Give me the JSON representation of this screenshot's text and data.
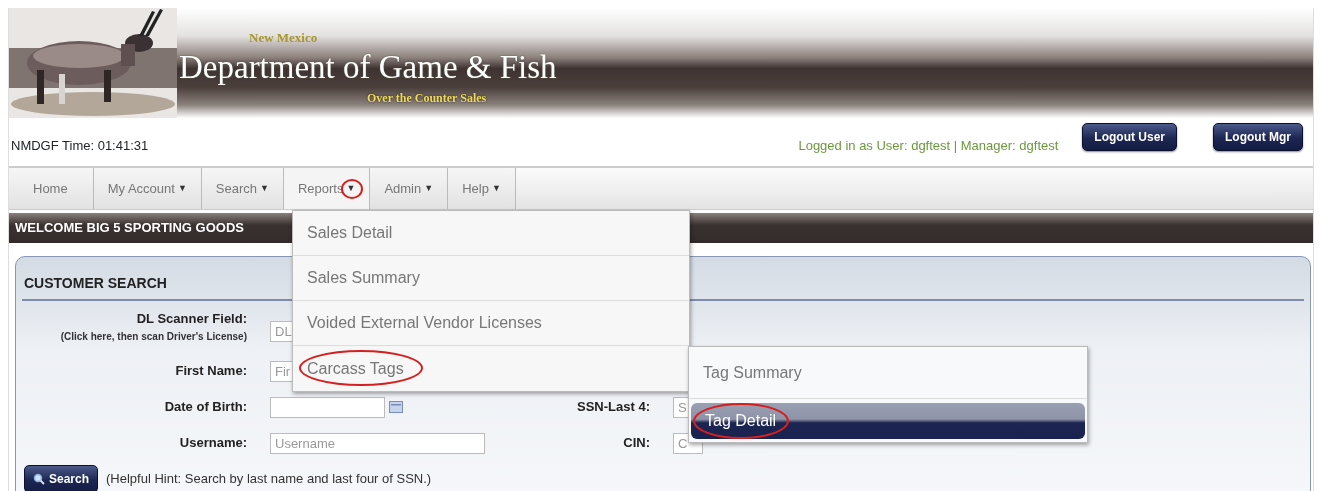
{
  "banner": {
    "state_name": "New Mexico",
    "title": "Department of Game & Fish",
    "subtitle": "Over the Counter Sales"
  },
  "info_bar": {
    "clock": "NMDGF Time: 01:41:31",
    "login": "Logged in as User: dgftest | Manager: dgftest",
    "buttons": [
      "Logout User",
      "Logout Mgr"
    ]
  },
  "nav": [
    {
      "label": "Home",
      "open": false,
      "circled": false
    },
    {
      "label": "My Account",
      "caret": "▼",
      "open": false,
      "circled": false
    },
    {
      "label": "Search",
      "caret": "▼",
      "open": false,
      "circled": false
    },
    {
      "label": "Reports",
      "caret": "▼",
      "open": true,
      "circled": true
    },
    {
      "label": "Admin",
      "caret": "▼",
      "open": false,
      "circled": false
    },
    {
      "label": "Help",
      "caret": "▼",
      "open": false,
      "circled": false
    }
  ],
  "reports_menu": [
    {
      "label": "Sales Detail",
      "circled": false
    },
    {
      "label": "Sales Summary",
      "circled": false
    },
    {
      "label": "Voided External Vendor Licenses",
      "circled": false
    },
    {
      "label": "Carcass Tags",
      "circled": true,
      "children": [
        {
          "label": "Tag Summary",
          "selected": false,
          "circled": false
        },
        {
          "label": "Tag Detail",
          "selected": true,
          "circled": true
        }
      ]
    }
  ],
  "welcome": "WELCOME BIG 5 SPORTING GOODS",
  "customer_search": {
    "title": "CUSTOMER SEARCH",
    "rows": [
      {
        "label": "DL Scanner Field:",
        "sublabel": "(Click here, then scan Driver's License)",
        "kind": "text",
        "placeholder": "DL"
      },
      {
        "label": "First Name:",
        "kind": "text",
        "placeholder": "Fir"
      },
      {
        "label": "Date of Birth:",
        "kind": "date",
        "right_label": "SSN-Last 4:",
        "right_placeholder": "S"
      },
      {
        "label": "Username:",
        "kind": "text",
        "placeholder": "Username",
        "right_label": "CIN:",
        "right_placeholder": "C"
      }
    ],
    "search_button": "Search",
    "hint": "(Helpful Hint: Search by last name and last four of SSN.)"
  }
}
